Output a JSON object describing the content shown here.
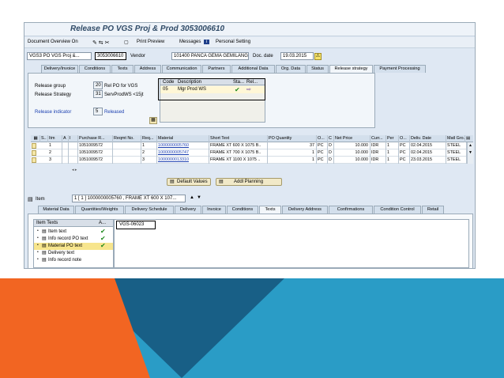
{
  "window": {
    "title": "Release PO VGS Proj & Prod 3053006610"
  },
  "menubar": {
    "doc_overview": "Document Overview On",
    "print_preview": "Print Preview",
    "messages": "Messages",
    "personal_setting": "Personal Setting"
  },
  "header": {
    "doc_type": "VGS3 PO VGS Proj &...",
    "po_number": "3053006610",
    "vendor_label": "Vendor",
    "vendor_value": "101400 PANCA GEMA GEMILANG",
    "doc_date_label": "Doc. date",
    "doc_date_value": "19.03.2015"
  },
  "header_tabs": [
    "Delivery/Invoice",
    "Conditions",
    "Texts",
    "Address",
    "Communication",
    "Partners",
    "Additional Data",
    "Org. Data",
    "Status",
    "Release strategy",
    "Payment Processing"
  ],
  "release": {
    "group_label": "Release group",
    "group_code": "20",
    "group_desc": "Rel PO for VGS",
    "strategy_label": "Release Strategy",
    "strategy_code": "31",
    "strategy_desc": "ServProdWS <15jt",
    "indicator_label": "Release indicator",
    "indicator_code": "5",
    "indicator_desc": "Released",
    "table_headers": [
      "Code",
      "Description",
      "Sta...",
      "Rel..."
    ],
    "table_row": {
      "code": "05",
      "description": "Mgr Prod WS"
    }
  },
  "items_table": {
    "headers": [
      "S..",
      "Itm",
      "A",
      "I",
      "Purchase R...",
      "Reqmt No.",
      "Req...",
      "Material",
      "Short Text",
      "PO Quantity",
      "O...",
      "C",
      "Net Price",
      "Curr...",
      "Per",
      "O...",
      "Deliv. Date",
      "Matl Gro..."
    ],
    "rows": [
      {
        "itm": "1",
        "pr": "1051009572",
        "req": "1",
        "material": "1000000005760",
        "short": "FRAME XT 600 X 1075 B..",
        "qty": "37",
        "uom": "PC",
        "c": "D",
        "price": "10.000",
        "curr": "IDR",
        "per": "1",
        "o": "PC",
        "date": "02.04.2015",
        "grp": "STEEL"
      },
      {
        "itm": "2",
        "pr": "1051009572",
        "req": "2",
        "material": "1000000005747",
        "short": "FRAME XT 700 X 1075 B..",
        "qty": "1",
        "uom": "PC",
        "c": "D",
        "price": "10.000",
        "curr": "IDR",
        "per": "1",
        "o": "PC",
        "date": "02.04.2015",
        "grp": "STEEL"
      },
      {
        "itm": "3",
        "pr": "1051009572",
        "req": "3",
        "material": "1000000013310",
        "short": "FRAME XT 1100 X 1075 ..",
        "qty": "1",
        "uom": "PC",
        "c": "D",
        "price": "10.000",
        "curr": "IDR",
        "per": "1",
        "o": "PC",
        "date": "23.03.2015",
        "grp": "STEEL"
      }
    ]
  },
  "buttons": {
    "default_values": "Default Values",
    "addl_planning": "Addl Planning"
  },
  "item_detail": {
    "item_label": "Item",
    "item_value": "1 [ 1 ] 1000000005760 , FRAME XT 600 X 107..."
  },
  "item_tabs": [
    "Material Data",
    "Quantities/Weights",
    "Delivery Schedule",
    "Delivery",
    "Invoice",
    "Conditions",
    "Texts",
    "Delivery Address",
    "Confirmations",
    "Condition Control",
    "Retail"
  ],
  "item_texts": {
    "header": "Item Texts",
    "header_col2": "A...",
    "entries": [
      "Item text",
      "Info record PO text",
      "Material PO text",
      "Delivery text",
      "Info record note"
    ],
    "editor_text": "VGS-06023"
  },
  "colors": {
    "orange": "#f26522",
    "teal": "#2a9cc6",
    "dark_blue": "#185f86"
  }
}
